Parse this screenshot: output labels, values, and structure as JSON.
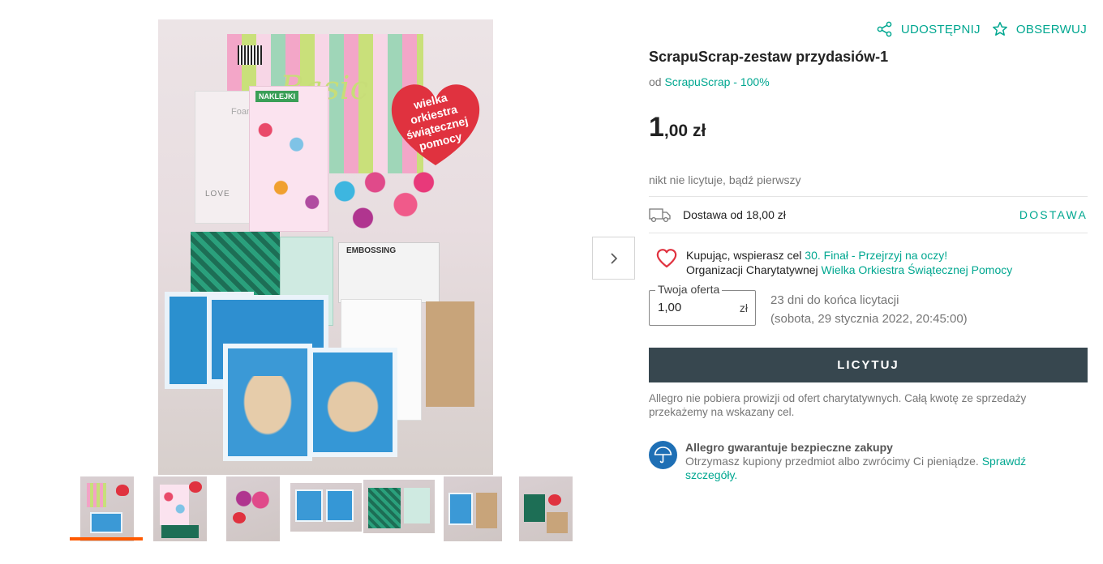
{
  "gallery": {
    "main_photo": {
      "heart_text": [
        "wielka orkiestra",
        "świątecznej",
        "pomocy"
      ],
      "sticker_label": "NAKLEJKI",
      "folder_label": "EMBOSSING",
      "love_label": "LOVE",
      "foam_label": "Foam",
      "paper_label": "Basic"
    },
    "thumbnails": [
      "thumb-1",
      "thumb-2",
      "thumb-3",
      "thumb-4",
      "thumb-5",
      "thumb-6",
      "thumb-7"
    ],
    "selected_thumbnail": 1
  },
  "actions": {
    "share_label": "UDOSTĘPNIJ",
    "watch_label": "OBSERWUJ"
  },
  "product": {
    "title": "ScrapuScrap-zestaw przydasiów-1",
    "seller_prefix": "od",
    "seller_link": "ScrapuScrap - 100%",
    "price_main": "1",
    "price_fraction": ",00 zł",
    "bids_text": "nikt nie licytuje, bądź pierwszy"
  },
  "delivery": {
    "label": "Dostawa od 18,00 zł",
    "link": "DOSTAWA"
  },
  "charity": {
    "line1_prefix": "Kupując, wspierasz cel",
    "line1_link": "30. Finał - Przejrzyj na oczy!",
    "line2_prefix": "Organizacji Charytatywnej",
    "line2_link": "Wielka Orkiestra Świątecznej Pomocy"
  },
  "offer": {
    "legend": "Twoja oferta",
    "value": "1,00",
    "currency": "zł",
    "ends_line1": "23 dni do końca licytacji",
    "ends_line2": "(sobota, 29 stycznia 2022, 20:45:00)"
  },
  "bid_button": "LICYTUJ",
  "note": "Allegro nie pobiera prowizji od ofert charytatywnych. Całą kwotę ze sprzedaży przekażemy na wskazany cel.",
  "guarantee": {
    "title": "Allegro gwarantuje bezpieczne zakupy",
    "text": "Otrzymasz kupiony przedmiot albo zwrócimy Ci pieniądze.",
    "link": "Sprawdź szczegóły."
  },
  "colors": {
    "accent": "#00a790",
    "button": "#37474f",
    "selected_thumb": "#ff5a00",
    "heart": "#e0323f"
  }
}
